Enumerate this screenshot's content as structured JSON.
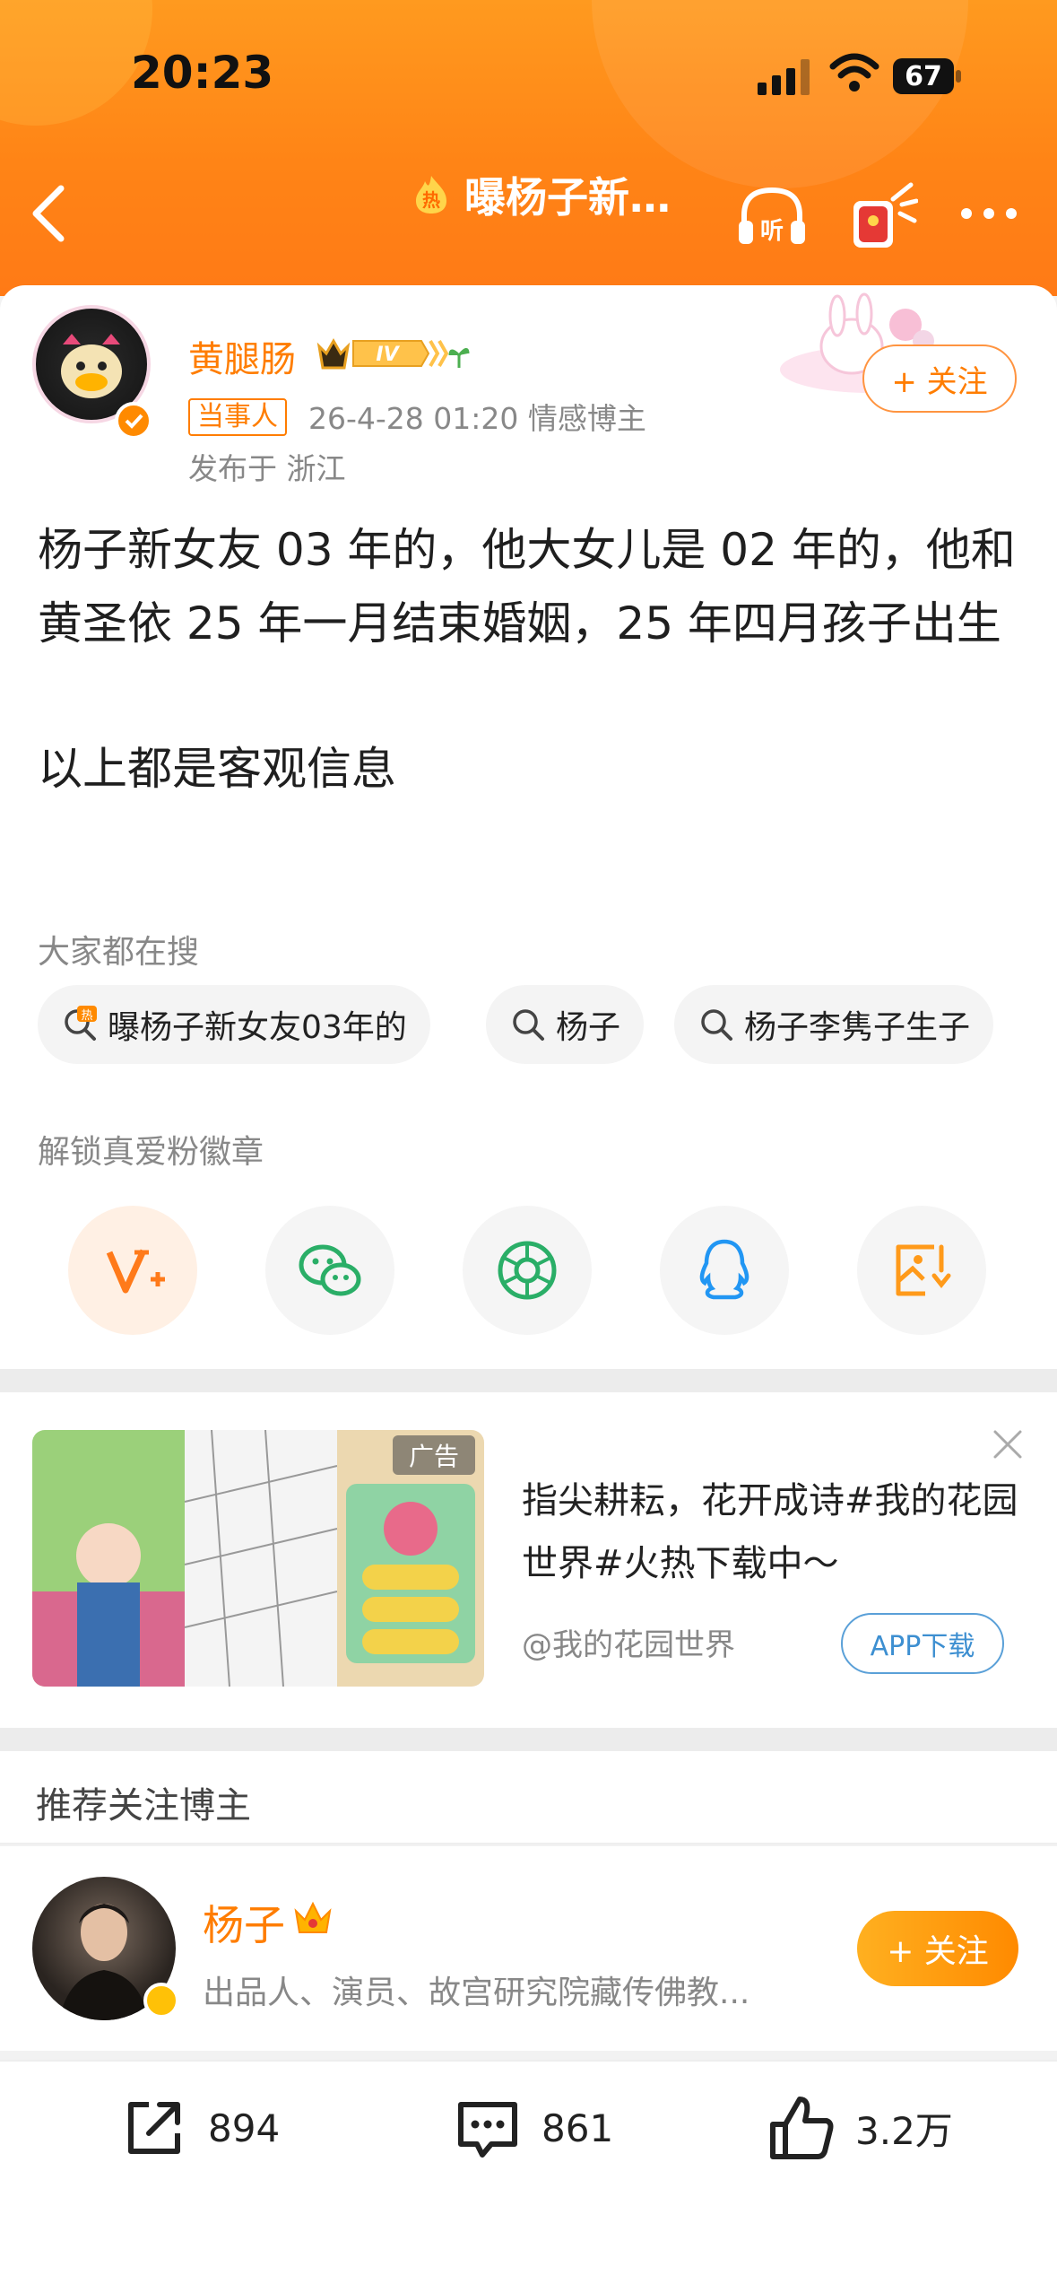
{
  "status_bar": {
    "time": "20:23",
    "battery": "67"
  },
  "nav": {
    "title": "曝杨子新…",
    "hot_badge": "热"
  },
  "post": {
    "author": "黄腿肠",
    "level": "IV",
    "role_tag": "当事人",
    "meta": "26-4-28 01:20  情感博主",
    "location": "发布于 浙江",
    "follow_label": "+ 关注",
    "paragraphs": [
      "杨子新女友 03 年的，他大女儿是 02 年的，他和黄圣依 25 年一月结束婚姻，25 年四月孩子出生",
      "以上都是客观信息"
    ]
  },
  "search": {
    "label": "大家都在搜",
    "chips": [
      "曝杨子新女友03年的",
      "杨子",
      "杨子李隽子生子"
    ]
  },
  "unlock": {
    "label": "解锁真爱粉徽章",
    "share_targets": [
      "weibo-fan-icon",
      "wechat-icon",
      "moments-icon",
      "qq-icon",
      "save-image-icon"
    ]
  },
  "ad": {
    "tag": "广告",
    "text": "指尖耕耘，花开成诗#我的花园世界#火热下载中～",
    "source": "@我的花园世界",
    "download_label": "APP下载"
  },
  "recommend": {
    "title": "推荐关注博主",
    "name": "杨子",
    "desc": "出品人、演员、故宫研究院藏传佛教...",
    "follow_label": "+ 关注"
  },
  "actions": {
    "share_count": "894",
    "comment_count": "861",
    "like_count": "3.2万"
  },
  "colors": {
    "accent": "#ff7d00",
    "header": "#ff8a1a",
    "link_blue": "#3d8fd1"
  }
}
